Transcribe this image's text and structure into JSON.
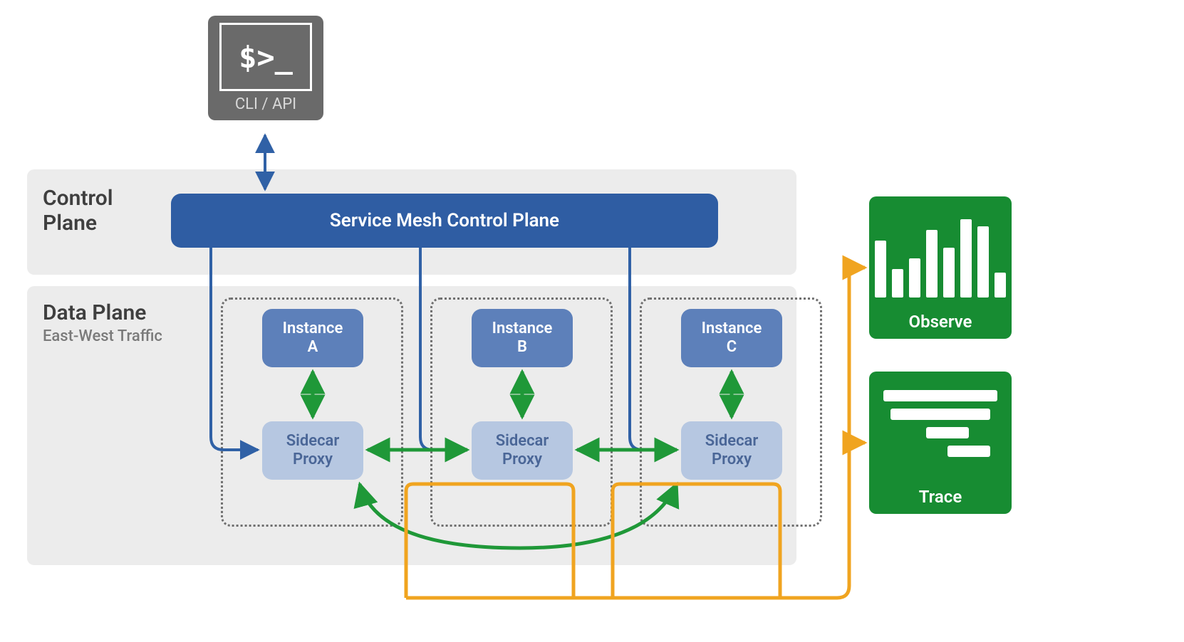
{
  "cli": {
    "prompt": "$>_",
    "label": "CLI / API"
  },
  "control_plane": {
    "title": "Control Plane",
    "banner": "Service Mesh Control Plane"
  },
  "data_plane": {
    "title": "Data Plane",
    "subtitle": "East-West Traffic"
  },
  "pods": [
    {
      "instance_line1": "Instance",
      "instance_line2": "A",
      "proxy_line1": "Sidecar",
      "proxy_line2": "Proxy"
    },
    {
      "instance_line1": "Instance",
      "instance_line2": "B",
      "proxy_line1": "Sidecar",
      "proxy_line2": "Proxy"
    },
    {
      "instance_line1": "Instance",
      "instance_line2": "C",
      "proxy_line1": "Sidecar",
      "proxy_line2": "Proxy"
    }
  ],
  "side_boxes": {
    "observe": "Observe",
    "trace": "Trace"
  },
  "colors": {
    "blue": "#3061a6",
    "green": "#1f9838",
    "amber": "#f0a420"
  }
}
